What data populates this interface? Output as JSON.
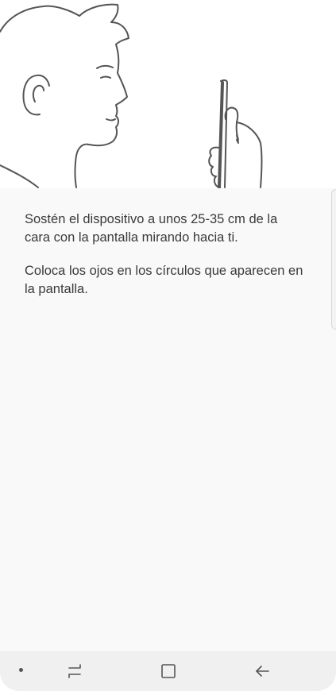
{
  "instructions": {
    "paragraph_1": "Sostén el dispositivo a unos 25-35 cm de la cara con la pantalla mirando hacia ti.",
    "paragraph_2": "Coloca los ojos en los círculos que aparecen en la pantalla."
  },
  "illustration": {
    "icon": "face-holding-phone-illustration"
  },
  "navbar": {
    "icons": [
      "keyboard-dot-icon",
      "recent-apps-icon",
      "home-icon",
      "back-icon"
    ]
  },
  "colors": {
    "background": "#f9f9f9",
    "text": "#3a3a3a",
    "navbar": "#f0f0f0",
    "line_art": "#555555"
  }
}
